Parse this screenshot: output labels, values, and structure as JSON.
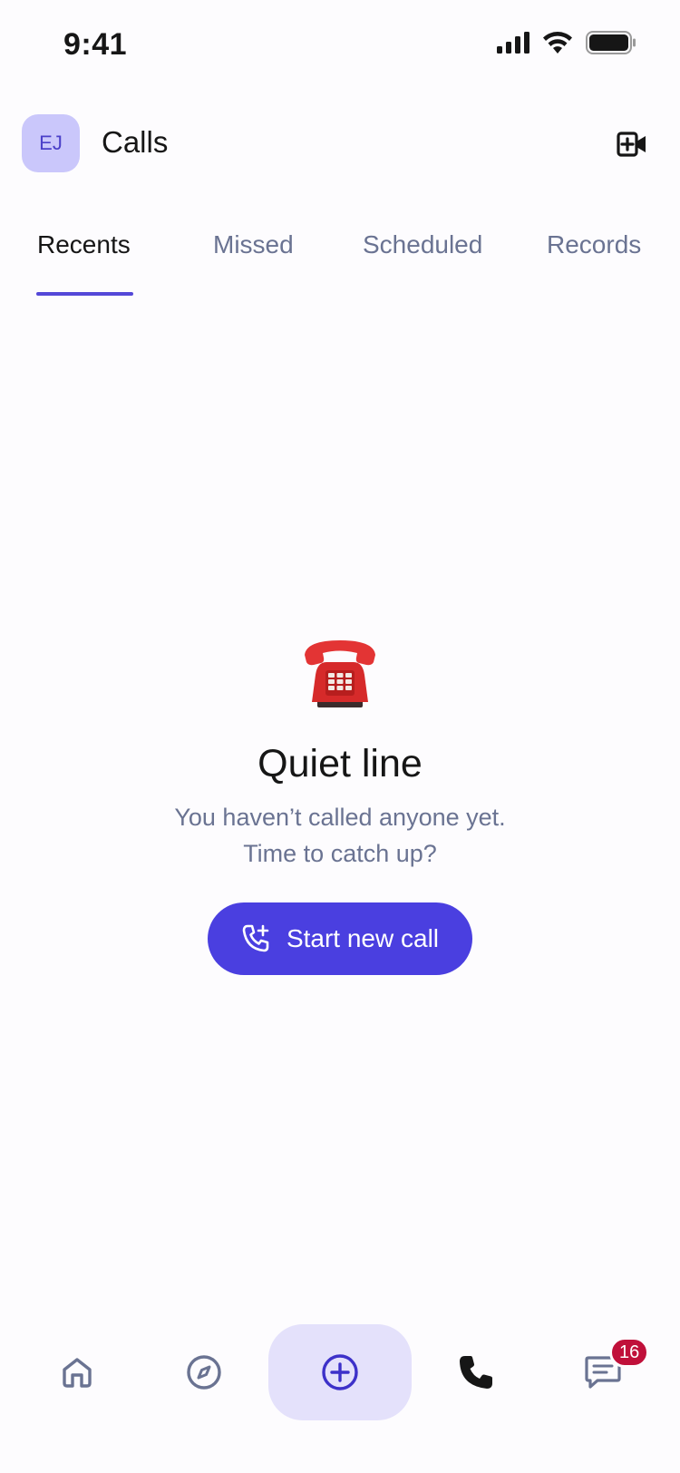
{
  "status_bar": {
    "time": "9:41"
  },
  "header": {
    "avatar_initials": "EJ",
    "title": "Calls"
  },
  "tabs": [
    {
      "label": "Recents",
      "active": true
    },
    {
      "label": "Missed",
      "active": false
    },
    {
      "label": "Scheduled",
      "active": false
    },
    {
      "label": "Records",
      "active": false
    }
  ],
  "empty_state": {
    "title": "Quiet line",
    "subtitle_line1": "You haven’t called anyone yet.",
    "subtitle_line2": "Time to catch up?",
    "button_label": "Start new call"
  },
  "bottom_nav": {
    "items": [
      "home-icon",
      "compass-icon",
      "plus-circle-icon",
      "phone-icon",
      "chat-icon"
    ],
    "messages_badge": "16"
  },
  "colors": {
    "accent": "#4a3fe0",
    "avatar_bg": "#cac7fb",
    "badge": "#c0103a",
    "muted_text": "#6a7392"
  }
}
